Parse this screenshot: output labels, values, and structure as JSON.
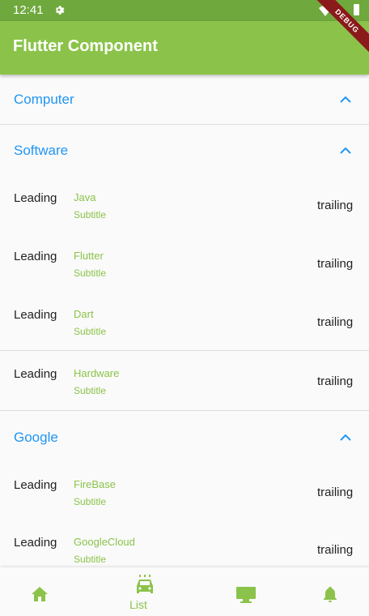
{
  "status_bar": {
    "time": "12:41",
    "icons": [
      "gear-icon",
      "wifi-icon",
      "battery-icon"
    ]
  },
  "app_bar": {
    "title": "Flutter Component"
  },
  "debug_banner": "DEBUG",
  "sections": {
    "computer": {
      "label": "Computer"
    },
    "software": {
      "label": "Software",
      "items": [
        {
          "leading": "Leading",
          "title": "Java",
          "subtitle": "Subtitle",
          "trailing": "trailing"
        },
        {
          "leading": "Leading",
          "title": "Flutter",
          "subtitle": "Subtitle",
          "trailing": "trailing"
        },
        {
          "leading": "Leading",
          "title": "Dart",
          "subtitle": "Subtitle",
          "trailing": "trailing"
        }
      ]
    },
    "hardware": {
      "leading": "Leading",
      "title": "Hardware",
      "subtitle": "Subtitle",
      "trailing": "trailing"
    },
    "google": {
      "label": "Google",
      "items": [
        {
          "leading": "Leading",
          "title": "FireBase",
          "subtitle": "Subtitle",
          "trailing": "trailing"
        },
        {
          "leading": "Leading",
          "title": "GoogleCloud",
          "subtitle": "Subtitle",
          "trailing": "trailing"
        }
      ]
    }
  },
  "bottom_nav": {
    "items": [
      {
        "icon": "home-icon",
        "label": ""
      },
      {
        "icon": "car-icon",
        "label": "List"
      },
      {
        "icon": "desktop-icon",
        "label": ""
      },
      {
        "icon": "bell-icon",
        "label": ""
      }
    ],
    "selected": 1
  },
  "colors": {
    "primary": "#8bc34a",
    "status_bar": "#6fa83d",
    "accent": "#2196f3",
    "debug": "#8b1a1a"
  }
}
